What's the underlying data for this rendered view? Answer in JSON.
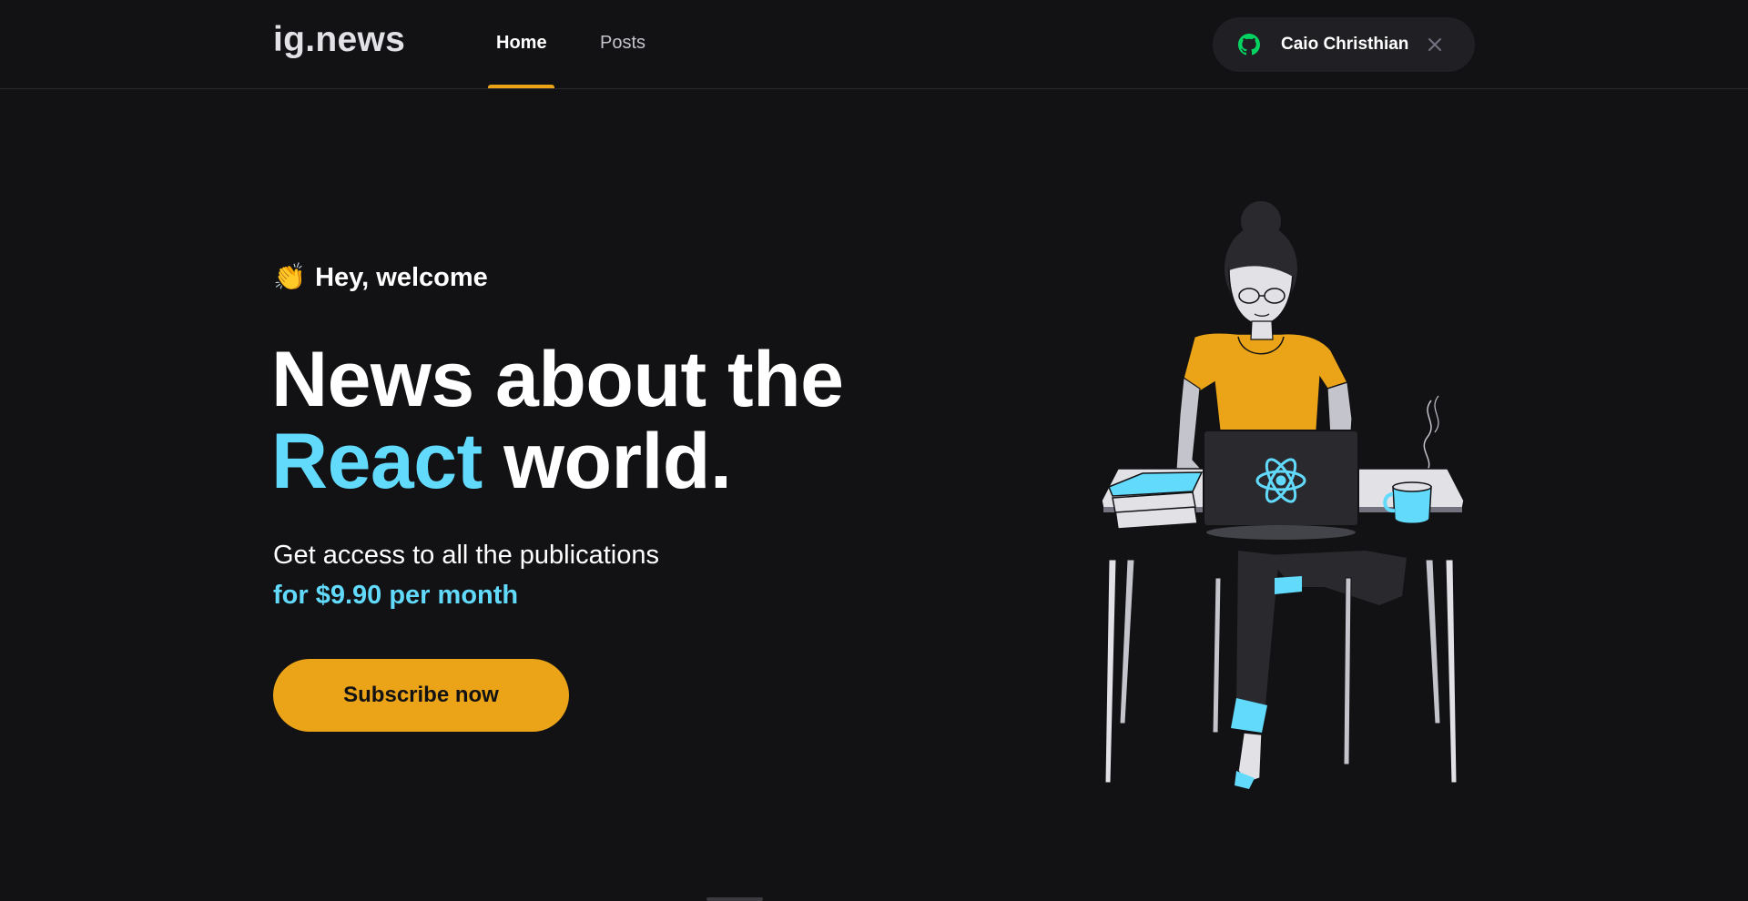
{
  "header": {
    "logo": "ig.news",
    "nav": [
      {
        "label": "Home",
        "active": true
      },
      {
        "label": "Posts",
        "active": false
      }
    ],
    "user": {
      "name": "Caio Christhian",
      "provider_icon": "github-icon",
      "signout_icon": "close-icon"
    }
  },
  "hero": {
    "welcome_emoji": "👏",
    "welcome_text": "Hey, welcome",
    "title_line1": "News about the",
    "title_accent": "React",
    "title_rest": " world.",
    "subtitle": "Get access to all the publications",
    "price": "for $9.90 per month",
    "cta_label": "Subscribe now"
  },
  "colors": {
    "background": "#121214",
    "accent_yellow": "#eba417",
    "accent_cyan": "#61dafb",
    "github_green": "#04d361",
    "pill_background": "#202024"
  },
  "illustration": {
    "description_icon": "woman-at-laptop-illustration",
    "laptop_icon": "react-logo-icon"
  }
}
